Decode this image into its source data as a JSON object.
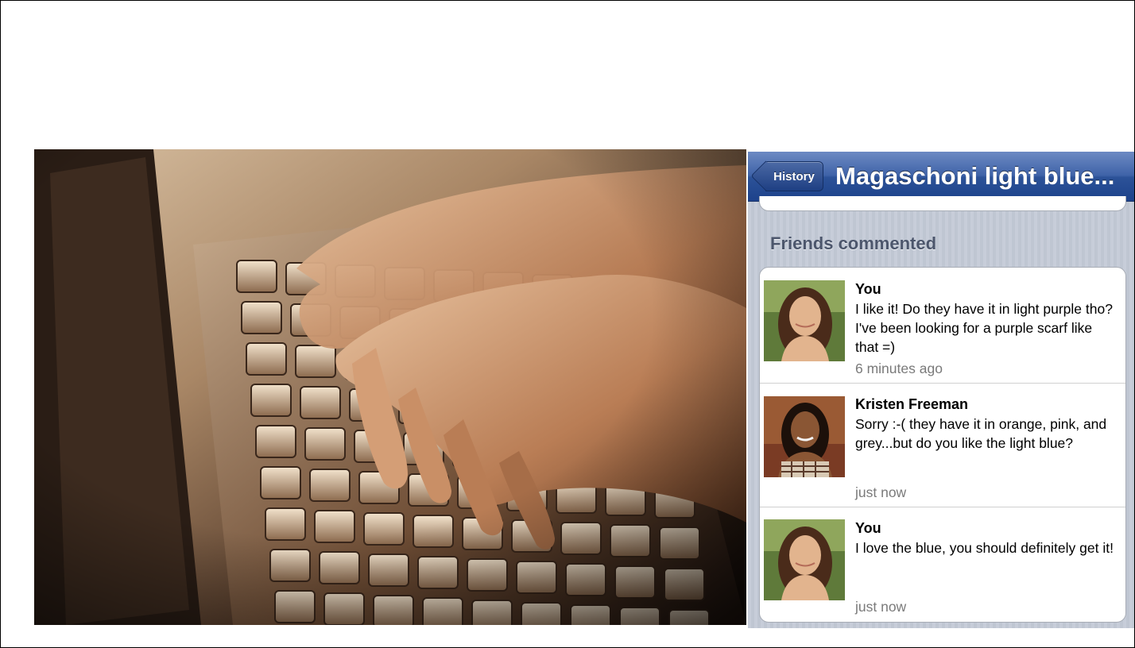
{
  "nav": {
    "back_label": "History",
    "title": "Magaschoni light blue..."
  },
  "section": {
    "header": "Friends commented"
  },
  "comments": [
    {
      "author": "You",
      "text": "I like it! Do they have it in light purple tho? I've been looking for a purple scarf like that =)",
      "time": "6 minutes ago"
    },
    {
      "author": "Kristen Freeman",
      "text": "Sorry :-( they have it in orange, pink, and grey...but do you like the light blue?",
      "time": "just now"
    },
    {
      "author": "You",
      "text": "I love the blue, you should definitely get it!",
      "time": "just now"
    }
  ],
  "colors": {
    "nav_bar": "#2c5298",
    "section_header": "#4c566c",
    "timestamp": "#7a7a7a",
    "page_background": "#c4cad6"
  }
}
